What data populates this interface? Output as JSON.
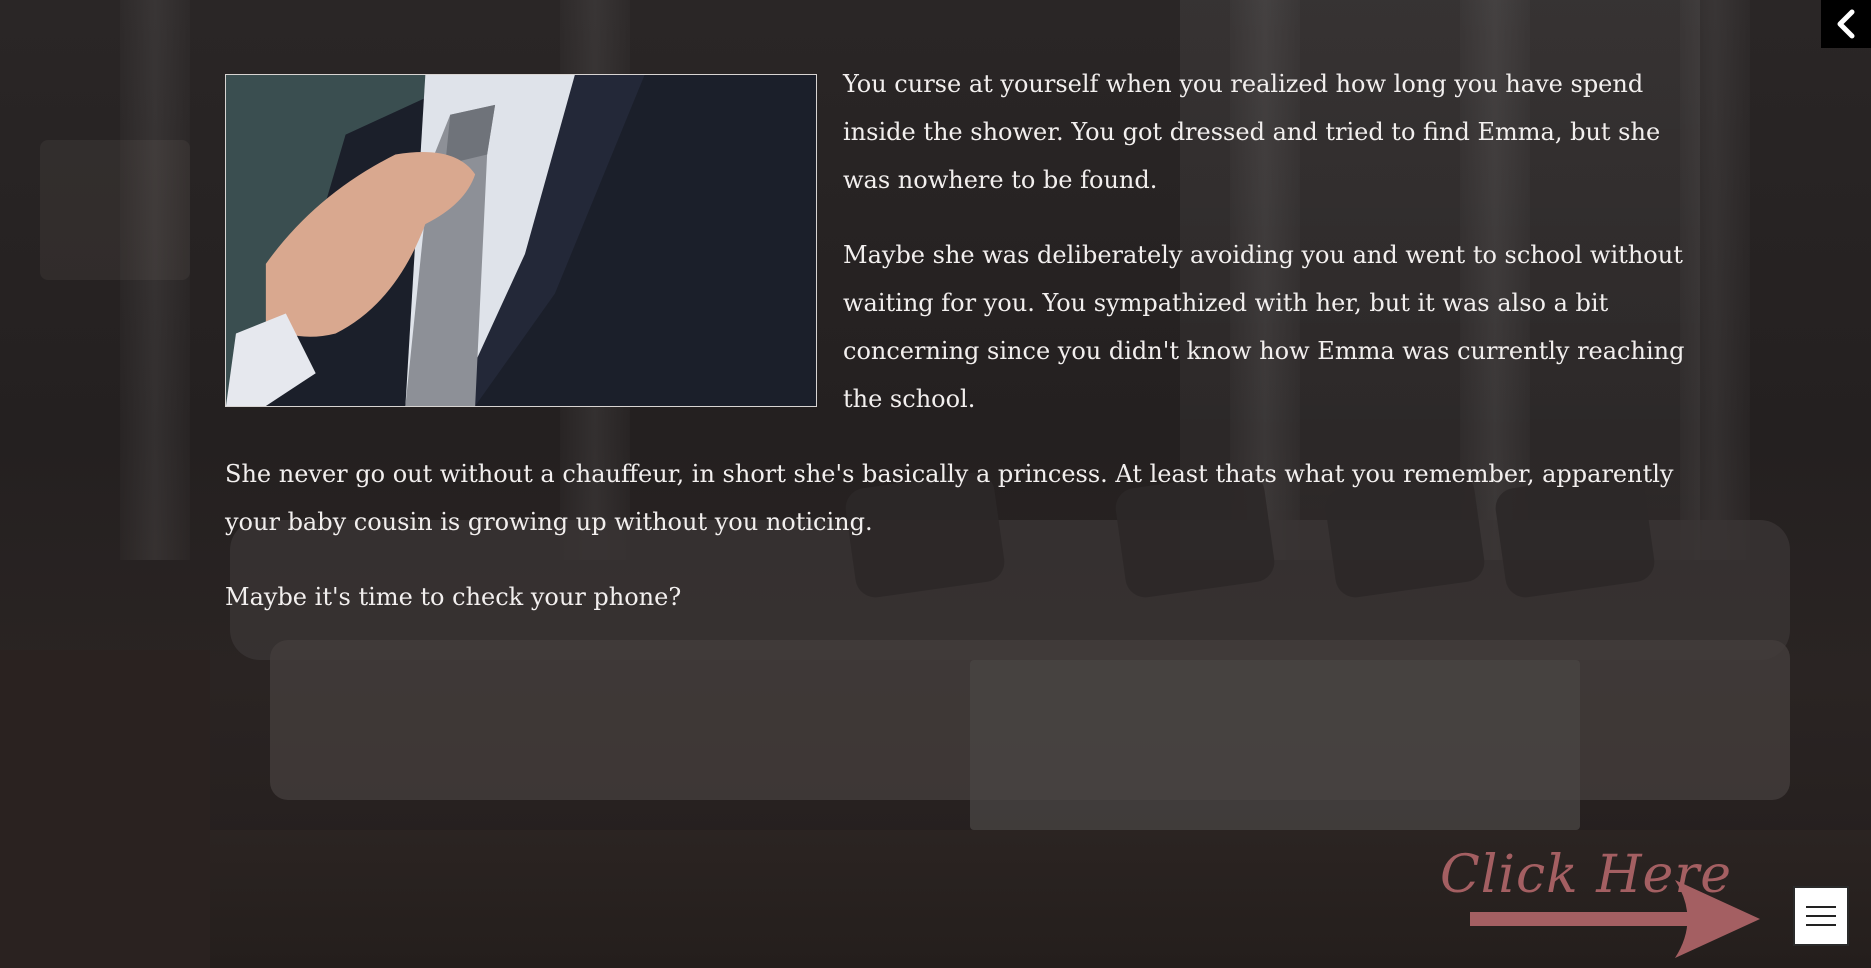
{
  "passage": {
    "paragraphs": [
      "You curse at yourself when you realized how long you have spend inside the shower. You got dressed and tried to find Emma, but she was nowhere to be found.",
      "Maybe she was deliberately avoiding you and went to school without waiting for you. You sympathized with her, but it was also a bit concerning since you didn't know how Emma was currently reaching the school.",
      "She never go out without a chauffeur, in short she's basically a princess. At least thats what you remember, apparently your baby cousin is growing up without you noticing.",
      "Maybe it's time to check your phone?"
    ]
  },
  "hint": {
    "label": "Click Here"
  },
  "colors": {
    "hint_accent": "#a45f62",
    "text": "#f2efee",
    "overlay": "#1d1a1a"
  },
  "icons": {
    "back": "chevron-left-icon",
    "menu": "hamburger-menu-icon",
    "hint_arrow": "arrow-right-icon"
  }
}
